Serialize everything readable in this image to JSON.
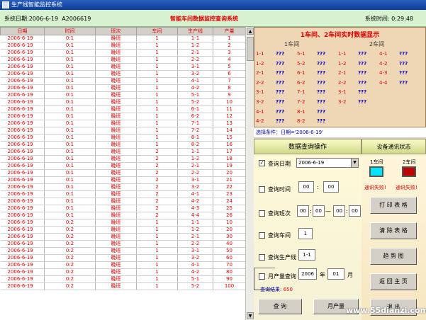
{
  "window": {
    "title": "生产线智能监控系统"
  },
  "infobar": {
    "date_label": "系统日期:2006-6-19",
    "id": "A2006619",
    "app_title": "智能车间数据监控查询系统",
    "time_label": "系统时间: 0:29:48"
  },
  "table": {
    "headers": [
      "日期",
      "时间",
      "班次",
      "车间",
      "生产线",
      "产量"
    ],
    "rows": [
      [
        "2006-6-19",
        "0:1",
        "晚班",
        "1",
        "1-1",
        "1"
      ],
      [
        "2006-6-19",
        "0:1",
        "晚班",
        "1",
        "1-2",
        "2"
      ],
      [
        "2006-6-19",
        "0:1",
        "晚班",
        "1",
        "2-1",
        "3"
      ],
      [
        "2006-6-19",
        "0:1",
        "晚班",
        "1",
        "2-2",
        "4"
      ],
      [
        "2006-6-19",
        "0:1",
        "晚班",
        "1",
        "3-1",
        "5"
      ],
      [
        "2006-6-19",
        "0:1",
        "晚班",
        "1",
        "3-2",
        "6"
      ],
      [
        "2006-6-19",
        "0:1",
        "晚班",
        "1",
        "4-1",
        "7"
      ],
      [
        "2006-6-19",
        "0:1",
        "晚班",
        "1",
        "4-2",
        "8"
      ],
      [
        "2006-6-19",
        "0:1",
        "晚班",
        "1",
        "5-1",
        "9"
      ],
      [
        "2006-6-19",
        "0:1",
        "晚班",
        "1",
        "5-2",
        "10"
      ],
      [
        "2006-6-19",
        "0:1",
        "晚班",
        "1",
        "6-1",
        "11"
      ],
      [
        "2006-6-19",
        "0:1",
        "晚班",
        "1",
        "6-2",
        "12"
      ],
      [
        "2006-6-19",
        "0:1",
        "晚班",
        "1",
        "7-1",
        "13"
      ],
      [
        "2006-6-19",
        "0:1",
        "晚班",
        "1",
        "7-2",
        "14"
      ],
      [
        "2006-6-19",
        "0:1",
        "晚班",
        "1",
        "8-1",
        "15"
      ],
      [
        "2006-6-19",
        "0:1",
        "晚班",
        "1",
        "8-2",
        "16"
      ],
      [
        "2006-6-19",
        "0:1",
        "晚班",
        "2",
        "1-1",
        "17"
      ],
      [
        "2006-6-19",
        "0:1",
        "晚班",
        "2",
        "1-2",
        "18"
      ],
      [
        "2006-6-19",
        "0:1",
        "晚班",
        "2",
        "2-1",
        "19"
      ],
      [
        "2006-6-19",
        "0:1",
        "晚班",
        "2",
        "2-2",
        "20"
      ],
      [
        "2006-6-19",
        "0:1",
        "晚班",
        "2",
        "3-1",
        "21"
      ],
      [
        "2006-6-19",
        "0:1",
        "晚班",
        "2",
        "3-2",
        "22"
      ],
      [
        "2006-6-19",
        "0:1",
        "晚班",
        "2",
        "4-1",
        "23"
      ],
      [
        "2006-6-19",
        "0:1",
        "晚班",
        "2",
        "4-2",
        "24"
      ],
      [
        "2006-6-19",
        "0:1",
        "晚班",
        "2",
        "4-3",
        "25"
      ],
      [
        "2006-6-19",
        "0:1",
        "晚班",
        "2",
        "4-4",
        "26"
      ],
      [
        "2006-6-19",
        "0:2",
        "晚班",
        "1",
        "1-1",
        "10"
      ],
      [
        "2006-6-19",
        "0:2",
        "晚班",
        "1",
        "1-2",
        "20"
      ],
      [
        "2006-6-19",
        "0:2",
        "晚班",
        "1",
        "2-1",
        "30"
      ],
      [
        "2006-6-19",
        "0:2",
        "晚班",
        "1",
        "2-2",
        "40"
      ],
      [
        "2006-6-19",
        "0:2",
        "晚班",
        "1",
        "3-1",
        "50"
      ],
      [
        "2006-6-19",
        "0:2",
        "晚班",
        "1",
        "3-2",
        "60"
      ],
      [
        "2006-6-19",
        "0:2",
        "晚班",
        "1",
        "4-1",
        "70"
      ],
      [
        "2006-6-19",
        "0:2",
        "晚班",
        "1",
        "4-2",
        "80"
      ],
      [
        "2006-6-19",
        "0:2",
        "晚班",
        "1",
        "5-1",
        "90"
      ],
      [
        "2006-6-19",
        "0:2",
        "晚班",
        "1",
        "5-2",
        "100"
      ]
    ]
  },
  "realtime": {
    "title": "1车间、2车间实时数据显示",
    "hdr1": "1车间",
    "hdr2": "2车间",
    "ws1_left": [
      [
        "1-1",
        "???"
      ],
      [
        "1-2",
        "???"
      ],
      [
        "2-1",
        "???"
      ],
      [
        "2-2",
        "???"
      ],
      [
        "3-1",
        "???"
      ],
      [
        "3-2",
        "???"
      ],
      [
        "4-1",
        "???"
      ],
      [
        "4-2",
        "???"
      ]
    ],
    "ws1_right": [
      [
        "5-1",
        "???"
      ],
      [
        "5-2",
        "???"
      ],
      [
        "6-1",
        "???"
      ],
      [
        "6-2",
        "???"
      ],
      [
        "7-1",
        "???"
      ],
      [
        "7-2",
        "???"
      ],
      [
        "8-1",
        "???"
      ],
      [
        "8-2",
        "???"
      ]
    ],
    "ws2_left": [
      [
        "1-1",
        "???"
      ],
      [
        "1-2",
        "???"
      ],
      [
        "2-1",
        "???"
      ],
      [
        "2-2",
        "???"
      ],
      [
        "3-1",
        "???"
      ],
      [
        "3-2",
        "???"
      ]
    ],
    "ws2_right": [
      [
        "4-1",
        "???"
      ],
      [
        "4-2",
        "???"
      ],
      [
        "4-3",
        "???"
      ],
      [
        "4-4",
        "???"
      ]
    ]
  },
  "condition": "选择条件：日期='2006-6-19'",
  "query": {
    "header": "数据查询操作",
    "query_date_label": "查询日期",
    "query_date_value": "2006-6-19",
    "query_time_label": "查询时间",
    "time_h": "00",
    "time_m": "00",
    "query_shift_label": "查询班次",
    "shift_a": "00",
    "shift_b": "00",
    "shift_c": "00",
    "shift_d": "00",
    "query_workshop_label": "查询车间",
    "workshop_value": "1",
    "query_line_label": "查询生产线",
    "line_value": "1-1",
    "monthly_label": "月产量查询",
    "year_value": "2006",
    "year_unit": "年",
    "month_value": "01",
    "month_unit": "月",
    "result_label": "查询结果:",
    "result_count": "650",
    "query_button": "查  询",
    "monthly_button": "月产量"
  },
  "device": {
    "header": "设备通讯状态",
    "ws1_label": "1车间",
    "ws2_label": "2车间",
    "ws1_status": "通讯失败!",
    "ws2_status": "通讯失败!",
    "ws1_color": "#00e5ff",
    "ws2_color": "#c00000"
  },
  "buttons": {
    "print": "打 印 表 格",
    "clear": "清 除 表 格",
    "trend": "趋 势 图",
    "home": "返 回 主 页",
    "exit": "退 出"
  },
  "watermark": "www.55dianzi.com"
}
